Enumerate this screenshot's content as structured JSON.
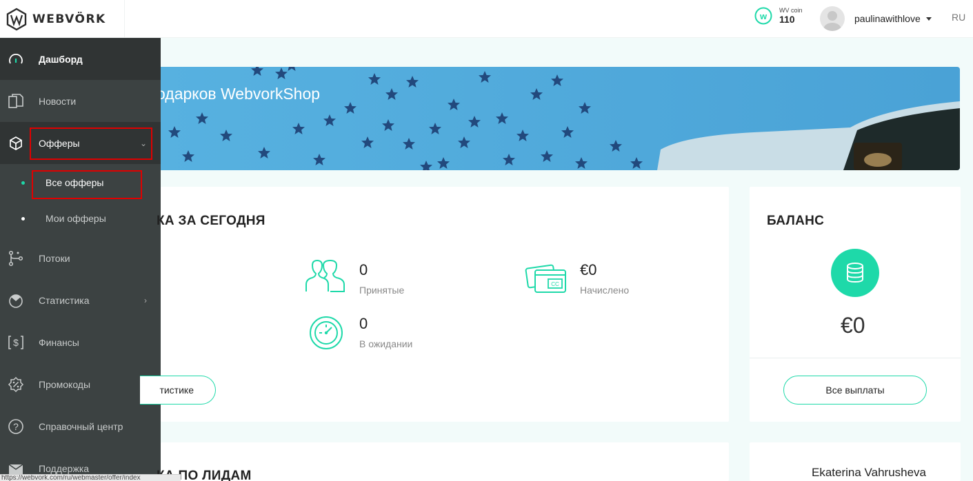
{
  "header": {
    "brand": "WEBVÖRK",
    "coin_label": "WV coin",
    "coin_value": "110",
    "username": "paulinawithlove",
    "language": "RU"
  },
  "sidebar": {
    "items": [
      {
        "label": "Дашборд",
        "icon": "gauge-icon"
      },
      {
        "label": "Новости",
        "icon": "document-icon"
      },
      {
        "label": "Офферы",
        "icon": "cube-icon"
      },
      {
        "label": "Потоки",
        "icon": "flow-icon"
      },
      {
        "label": "Статистика",
        "icon": "pie-chart-icon"
      },
      {
        "label": "Финансы",
        "icon": "dollar-icon"
      },
      {
        "label": "Промокоды",
        "icon": "percent-icon"
      },
      {
        "label": "Справочный центр",
        "icon": "question-icon"
      },
      {
        "label": "Поддержка",
        "icon": "mail-icon"
      }
    ],
    "sub_items": [
      {
        "label": "Все офферы"
      },
      {
        "label": "Мои офферы"
      }
    ]
  },
  "banner": {
    "title": "одарков WebvorkShop"
  },
  "today": {
    "title": "КА ЗА СЕГОДНЯ",
    "accepted_value": "0",
    "accepted_label": "Принятые",
    "accrued_value": "€0",
    "accrued_label": "Начислено",
    "pending_value": "0",
    "pending_label": "В ожидании",
    "button": "тистике"
  },
  "balance": {
    "title": "БАЛАНС",
    "amount": "€0",
    "button": "Все выплаты"
  },
  "leads": {
    "title": "КА ПО ЛИДАМ"
  },
  "manager": {
    "name": "Ekaterina Vahrusheva"
  },
  "status_url": "https://webvork.com/ru/webmaster/offer/index",
  "colors": {
    "accent": "#1ed9a9",
    "sidebar": "#3c4242",
    "highlight": "#e00000"
  }
}
